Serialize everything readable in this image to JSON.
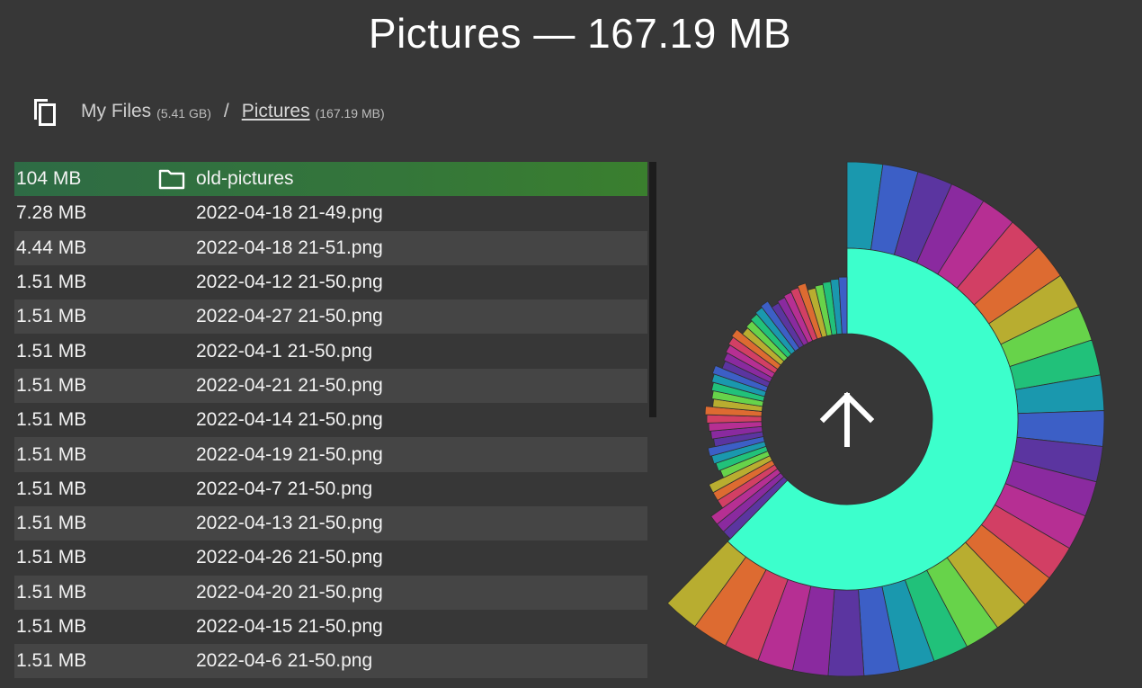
{
  "title": "Pictures — 167.19 MB",
  "breadcrumb": {
    "root_label": "My Files",
    "root_size": "(5.41 GB)",
    "separator": "/",
    "current_label": "Pictures",
    "current_size": "(167.19 MB)"
  },
  "files": [
    {
      "size": "104 MB",
      "name": "old-pictures",
      "is_folder": true,
      "icon": "folder-icon"
    },
    {
      "size": "7.28 MB",
      "name": "2022-04-18 21-49.png"
    },
    {
      "size": "4.44 MB",
      "name": "2022-04-18 21-51.png"
    },
    {
      "size": "1.51 MB",
      "name": "2022-04-12 21-50.png"
    },
    {
      "size": "1.51 MB",
      "name": "2022-04-27 21-50.png"
    },
    {
      "size": "1.51 MB",
      "name": "2022-04-1 21-50.png"
    },
    {
      "size": "1.51 MB",
      "name": "2022-04-21 21-50.png"
    },
    {
      "size": "1.51 MB",
      "name": "2022-04-14 21-50.png"
    },
    {
      "size": "1.51 MB",
      "name": "2022-04-19 21-50.png"
    },
    {
      "size": "1.51 MB",
      "name": "2022-04-7 21-50.png"
    },
    {
      "size": "1.51 MB",
      "name": "2022-04-13 21-50.png"
    },
    {
      "size": "1.51 MB",
      "name": "2022-04-26 21-50.png"
    },
    {
      "size": "1.51 MB",
      "name": "2022-04-20 21-50.png"
    },
    {
      "size": "1.51 MB",
      "name": "2022-04-15 21-50.png"
    },
    {
      "size": "1.51 MB",
      "name": "2022-04-6 21-50.png"
    },
    {
      "size": "",
      "name": ""
    }
  ],
  "icons": {
    "copy": "copy-icon",
    "up": "arrow-up-icon",
    "folder": "folder-icon"
  },
  "colors": {
    "background": "#373737",
    "row_alt": "#454545",
    "selected_start": "#2e6b45",
    "selected_end": "#3a7f2e",
    "inner_ring": "#3cffcc"
  },
  "palette": [
    "#1a98ae",
    "#3c5fc6",
    "#5b35a0",
    "#8a2a9f",
    "#b62f93",
    "#d23f64",
    "#dd6b31",
    "#b8ad30",
    "#67d34a",
    "#21c17a"
  ],
  "chart_data": {
    "type": "sunburst",
    "inner_ring": {
      "name": "old-pictures",
      "share": 0.623
    },
    "outer_ring_segments": 68
  }
}
